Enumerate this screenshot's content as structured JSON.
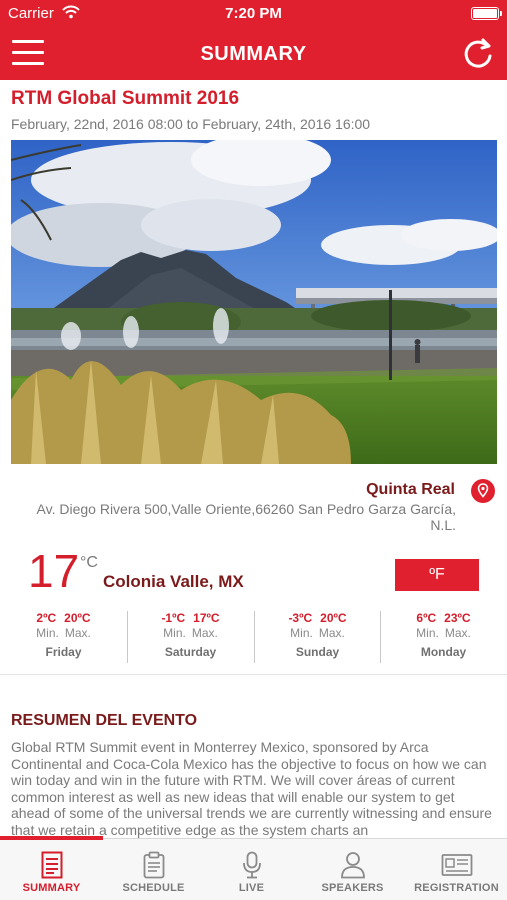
{
  "status_bar": {
    "carrier": "Carrier",
    "time": "7:20 PM"
  },
  "header": {
    "title": "SUMMARY",
    "menu_icon": "hamburger-menu-icon",
    "refresh_icon": "refresh-icon"
  },
  "event": {
    "title": "RTM Global Summit 2016",
    "dates": "February, 22nd, 2016  08:00 to February, 24th, 2016  16:00"
  },
  "venue": {
    "name": "Quinta Real",
    "address": "Av. Diego Rivera 500,Valle Oriente,66260 San Pedro Garza García, N.L.",
    "pin_icon": "location-pin-icon"
  },
  "weather": {
    "current_temp": "17",
    "unit": "°C",
    "city": "Colonia Valle, MX",
    "toggle_label": "ºF",
    "forecast": [
      {
        "min": "2ºC",
        "max": "20ºC",
        "min_label": "Min.",
        "max_label": "Max.",
        "day": "Friday"
      },
      {
        "min": "-1ºC",
        "max": "17ºC",
        "min_label": "Min.",
        "max_label": "Max.",
        "day": "Saturday"
      },
      {
        "min": "-3ºC",
        "max": "20ºC",
        "min_label": "Min.",
        "max_label": "Max.",
        "day": "Sunday"
      },
      {
        "min": "6ºC",
        "max": "23ºC",
        "min_label": "Min.",
        "max_label": "Max.",
        "day": "Monday"
      }
    ]
  },
  "summary": {
    "heading": "RESUMEN DEL EVENTO",
    "body": "Global RTM Summit event in Monterrey Mexico, sponsored by Arca Continental and Coca-Cola Mexico has the objective to focus on how we can win today and win in the future with RTM. We will cover áreas of current common interest as well as new ideas that will enable our system to get ahead of some of the universal trends we are currently witnessing and ensure that we retain a competitive edge as the system charts an"
  },
  "tabs": [
    {
      "label": "SUMMARY",
      "icon": "summary-document-icon",
      "active": true
    },
    {
      "label": "SCHEDULE",
      "icon": "schedule-clipboard-icon",
      "active": false
    },
    {
      "label": "LIVE",
      "icon": "microphone-icon",
      "active": false
    },
    {
      "label": "SPEAKERS",
      "icon": "speaker-person-icon",
      "active": false
    },
    {
      "label": "REGISTRATION",
      "icon": "registration-card-icon",
      "active": false
    }
  ],
  "colors": {
    "brand_red": "#e0202e",
    "dark_red": "#7a1a1a",
    "text_gray": "#7a7a7a"
  }
}
